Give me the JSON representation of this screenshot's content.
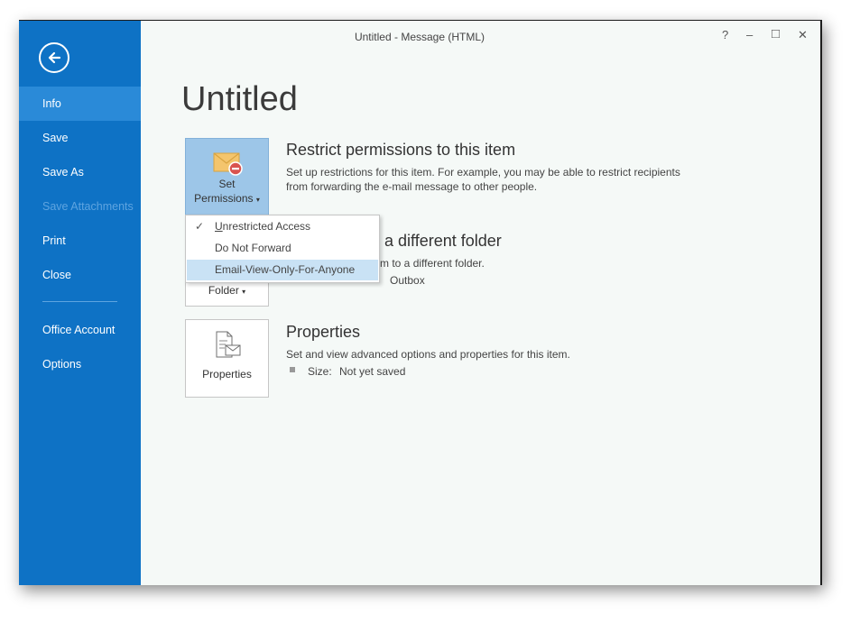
{
  "window": {
    "title": "Untitled - Message (HTML)",
    "controls": {
      "help": "?",
      "minimize": "–",
      "maximize": "□",
      "close": "✕"
    }
  },
  "sidebar": {
    "items": [
      {
        "label": "Info",
        "active": true
      },
      {
        "label": "Save"
      },
      {
        "label": "Save As"
      },
      {
        "label": "Save Attachments",
        "disabled": true
      },
      {
        "label": "Print"
      },
      {
        "label": "Close"
      },
      {
        "label": "Office Account"
      },
      {
        "label": "Options"
      }
    ]
  },
  "page": {
    "title": "Untitled"
  },
  "permissions": {
    "button_line1": "Set",
    "button_line2": "Permissions",
    "title": "Restrict permissions to this item",
    "desc_line1": "Set up restrictions for this item. For example, you may be able to restrict recipients",
    "desc_line2": "from forwarding the e-mail message to other people.",
    "menu": [
      {
        "label": "Unrestricted Access",
        "checked": true,
        "accel": "U",
        "rest": "nrestricted Access"
      },
      {
        "label": "Do Not Forward"
      },
      {
        "label": "Email-View-Only-For-Anyone",
        "highlighted": true
      }
    ]
  },
  "move": {
    "button_label": "Folder",
    "title_partial": "o a different folder",
    "desc_partial": "tem to a different folder.",
    "current_folder": "Outbox"
  },
  "properties": {
    "button_label": "Properties",
    "title": "Properties",
    "desc": "Set and view advanced options and properties for this item.",
    "size_label": "Size:",
    "size_value": "Not yet saved"
  },
  "colors": {
    "sidebar": "#0e72c5",
    "sidebar_active": "#2a8ad8",
    "accent_highlight": "#c9e2f5"
  }
}
